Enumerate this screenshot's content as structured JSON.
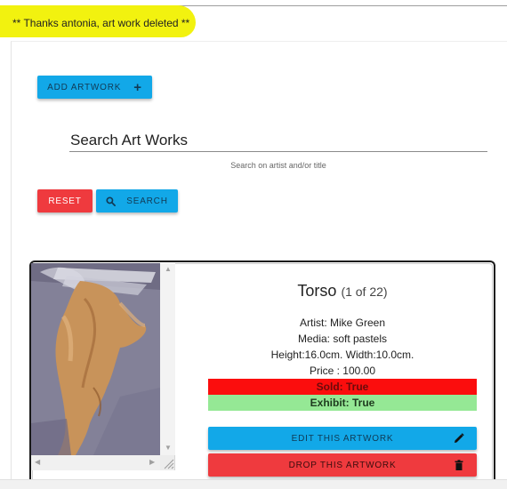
{
  "flash": {
    "message": "** Thanks antonia, art work deleted **"
  },
  "toolbar": {
    "add_artwork_label": "ADD ARTWORK",
    "add_icon": "plus-icon"
  },
  "search": {
    "placeholder": "Search Art Works",
    "helper_text": "Search on artist and/or title",
    "reset_label": "RESET",
    "search_label": "SEARCH",
    "search_icon": "search-icon"
  },
  "artwork": {
    "title": "Torso",
    "count_text": "(1 of 22)",
    "artist": "Artist: Mike Green",
    "media": "Media: soft pastels",
    "dimensions": "Height:16.0cm. Width:10.0cm.",
    "price": "Price : 100.00",
    "sold": "Sold: True",
    "exhibit": "Exhibit: True",
    "edit_label": "EDIT THIS ARTWORK",
    "edit_icon": "pencil-icon",
    "drop_label": "DROP THIS ARTWORK",
    "drop_icon": "trash-icon"
  },
  "colors": {
    "primary": "#12a8e8",
    "danger": "#ef3a3e",
    "sold_bg": "#fb0d0d",
    "exhibit_bg": "#95e895",
    "highlight": "#f2f20f"
  }
}
